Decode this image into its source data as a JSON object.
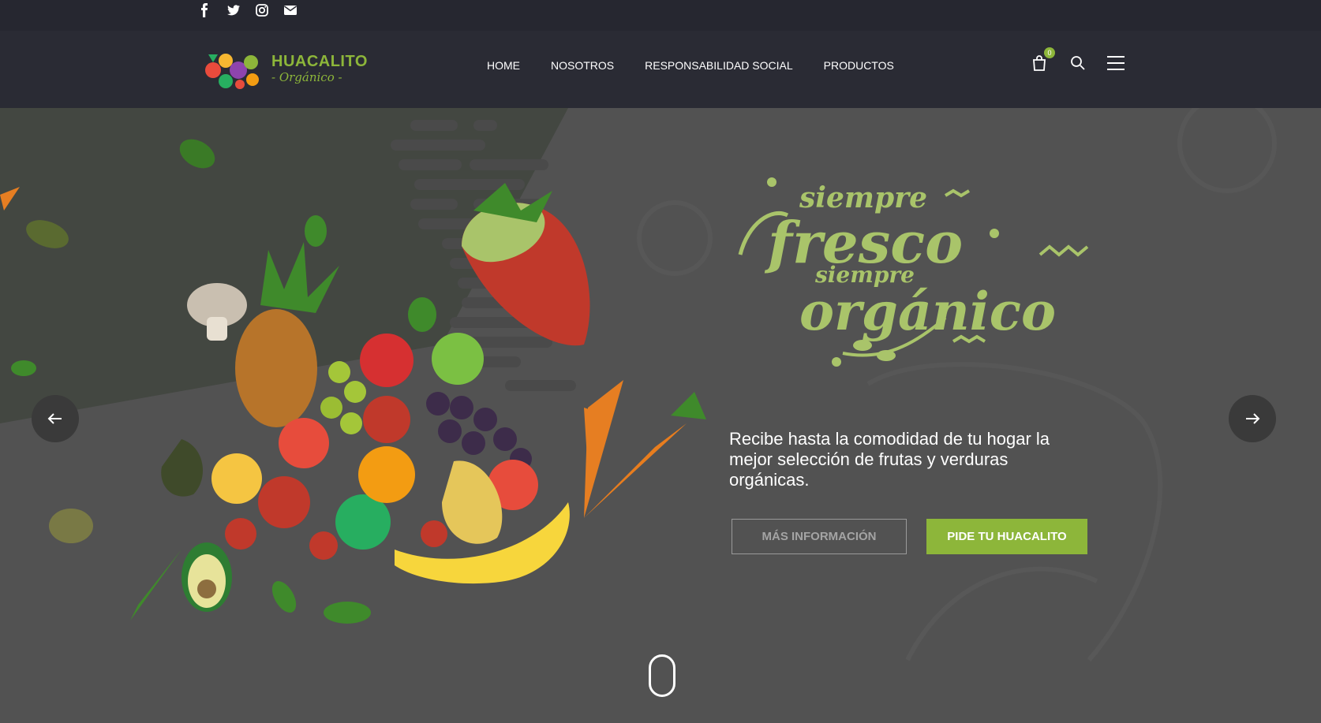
{
  "social": [
    {
      "name": "facebook-icon"
    },
    {
      "name": "twitter-icon"
    },
    {
      "name": "instagram-icon"
    },
    {
      "name": "envelope-icon"
    }
  ],
  "brand": {
    "title": "HUACALITO",
    "subtitle": "- Orgánico -"
  },
  "nav": {
    "items": [
      {
        "label": "HOME"
      },
      {
        "label": "NOSOTROS"
      },
      {
        "label": "RESPONSABILIDAD SOCIAL"
      },
      {
        "label": "PRODUCTOS"
      }
    ]
  },
  "cart": {
    "count": "0"
  },
  "hero": {
    "tagline_line1": "siempre",
    "tagline_line2": "fresco",
    "tagline_line3": "siempre",
    "tagline_line4": "orgánico",
    "description": "Recibe hasta la comodidad de tu hogar la mejor selección de frutas y verduras orgánicas.",
    "btn_more": "MÁS INFORMACIÓN",
    "btn_order": "PIDE TU HUACALITO"
  },
  "colors": {
    "accent": "#8db63a",
    "topbar": "#262730",
    "navbar": "#2a2b34",
    "hero_bg": "#525252"
  }
}
